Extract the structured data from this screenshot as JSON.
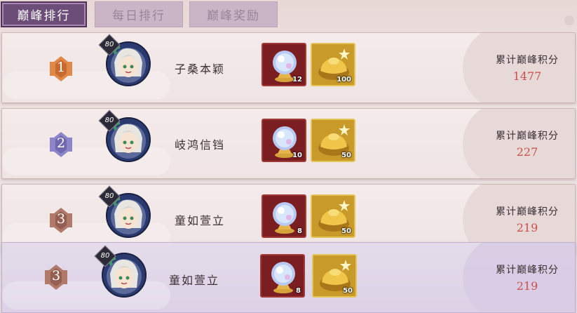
{
  "tabs": [
    {
      "label": "巅峰排行",
      "active": true
    },
    {
      "label": "每日排行",
      "active": false
    },
    {
      "label": "巅峰奖励",
      "active": false
    }
  ],
  "score_label": "累计巅峰积分",
  "colors": {
    "rank1": "#e0874a",
    "rank2": "#8c86c9",
    "rank3": "#b07a6a",
    "score": "#c9504b"
  },
  "rows": [
    {
      "rank": "1",
      "level": "80",
      "name": "子桑本颖",
      "orb_count": "12",
      "gold_count": "100",
      "score": "1477"
    },
    {
      "rank": "2",
      "level": "80",
      "name": "岐鸿信铛",
      "orb_count": "10",
      "gold_count": "50",
      "score": "227"
    },
    {
      "rank": "3",
      "level": "80",
      "name": "童如萱立",
      "orb_count": "8",
      "gold_count": "50",
      "score": "219"
    }
  ],
  "me": {
    "rank": "3",
    "level": "80",
    "name": "童如萱立",
    "orb_count": "8",
    "gold_count": "50",
    "score": "219"
  }
}
